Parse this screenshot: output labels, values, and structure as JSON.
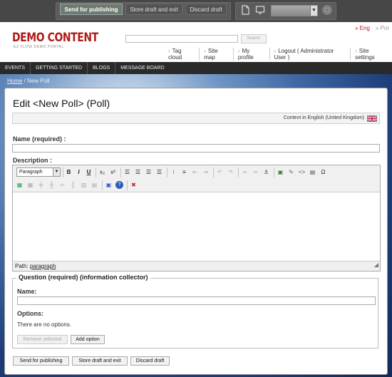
{
  "toolbar": {
    "send_label": "Send for publishing",
    "store_label": "Store draft and exit",
    "discard_label": "Discard draft"
  },
  "header": {
    "lang_active": "» Eng",
    "lang_other": "» Por",
    "logo": "DEMO CONTENT",
    "tagline": "EZ FLOW DEMO PORTAL",
    "search_button": "Search",
    "links": [
      "Tag cloud",
      "Site map",
      "My profile",
      "Logout ( Administrator User )",
      "Site settings"
    ]
  },
  "menu": [
    "EVENTS",
    "GETTING STARTED",
    "BLOGS",
    "MESSAGE BOARD"
  ],
  "breadcrumb": {
    "home": "Home",
    "sep": " / ",
    "current": "New Poll"
  },
  "page": {
    "title": "Edit <New Poll> (Poll)",
    "language": "Content in English (United Kingdom)"
  },
  "fields": {
    "name_label": "Name (required) :",
    "description_label": "Description :"
  },
  "editor": {
    "format_value": "Paragraph",
    "path_label": "Path:",
    "path_value": "paragraph",
    "icons": [
      "bold-icon",
      "italic-icon",
      "underline-icon",
      "subscript-icon",
      "superscript-icon",
      "align-left-icon",
      "align-center-icon",
      "align-right-icon",
      "justify-icon",
      "bullet-list-icon",
      "numbered-list-icon",
      "outdent-icon",
      "indent-icon",
      "undo-icon",
      "redo-icon",
      "link-icon",
      "unlink-icon",
      "anchor-icon",
      "insert-image-icon",
      "insert-object-icon",
      "literal-icon",
      "custom-tag-icon",
      "special-character-icon",
      "insert-table-icon",
      "delete-table-icon",
      "insert-row-icon",
      "insert-column-icon",
      "delete-row-icon",
      "delete-column-icon",
      "split-cell-icon",
      "merge-cell-icon",
      "toggle-visual-icon",
      "help-icon",
      "remove-icon"
    ]
  },
  "question": {
    "legend": "Question (required) (information collector)",
    "name_label": "Name:",
    "options_label": "Options:",
    "no_options": "There are no options.",
    "remove_label": "Remove selected",
    "add_label": "Add option"
  },
  "actions": {
    "send_label": "Send for publishing",
    "store_label": "Store draft and exit",
    "discard_label": "Discard draft"
  },
  "colors": {
    "brand": "#b11919",
    "toolbar_bg": "#474747",
    "menu_bg": "#2a2a2a"
  }
}
